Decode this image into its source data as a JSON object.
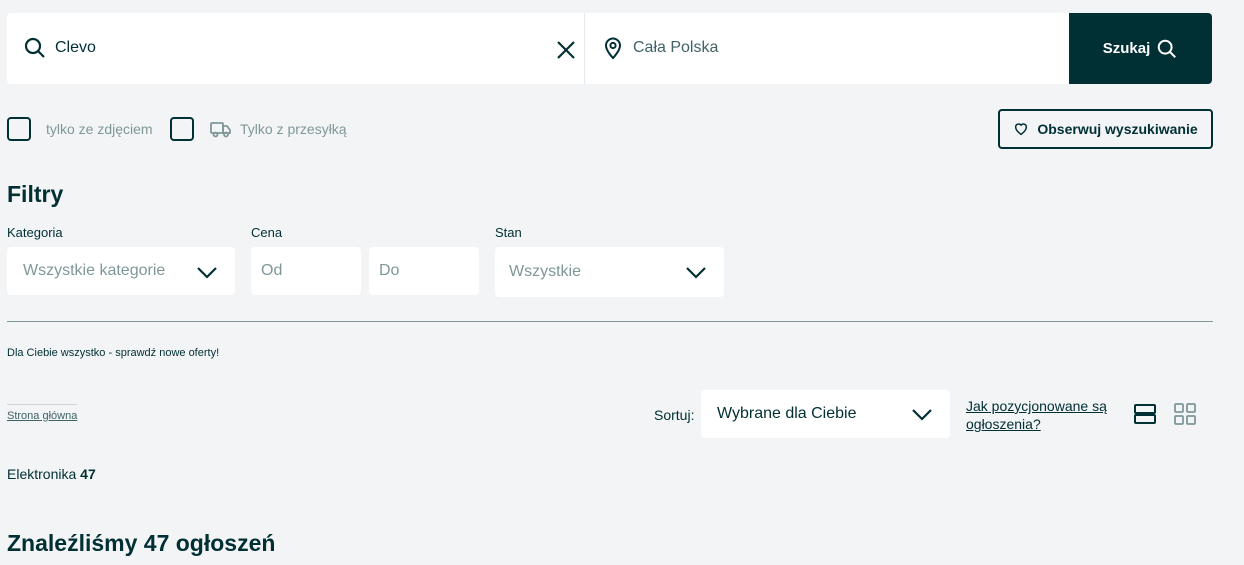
{
  "search": {
    "query": "Clevo",
    "location": "Cała Polska",
    "button_label": "Szukaj"
  },
  "options": {
    "photo_only_label": "tylko ze zdjęciem",
    "shipping_only_label": "Tylko z przesyłką",
    "observe_label": "Obserwuj wyszukiwanie"
  },
  "filters": {
    "title": "Filtry",
    "category": {
      "label": "Kategoria",
      "value": "Wszystkie kategorie"
    },
    "price": {
      "label": "Cena",
      "from_placeholder": "Od",
      "to_placeholder": "Do"
    },
    "condition": {
      "label": "Stan",
      "value": "Wszystkie"
    }
  },
  "promo_text": "Dla Ciebie wszystko - sprawdź nowe oferty!",
  "breadcrumb": {
    "home": "Strona główna"
  },
  "sort": {
    "label": "Sortuj:",
    "value": "Wybrane dla Ciebie",
    "info_link": "Jak pozycjonowane są ogłoszenia?"
  },
  "category_summary": {
    "name": "Elektronika",
    "count": "47"
  },
  "results_heading": "Znaleźliśmy 47 ogłoszeń",
  "colors": {
    "primary": "#002f34",
    "background": "#f2f4f5",
    "muted": "#7f9799"
  }
}
